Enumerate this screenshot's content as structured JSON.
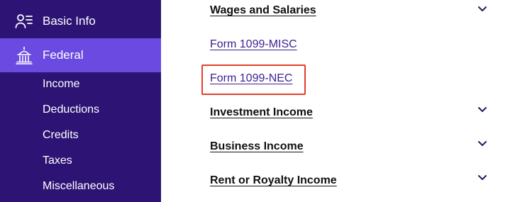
{
  "colors": {
    "sidebar_bg": "#2d1474",
    "active_bg": "#6a4ae0",
    "link": "#3b1f8f",
    "highlight": "#e2402a"
  },
  "sidebar": {
    "items": [
      {
        "label": "Basic Info",
        "icon": "person-list-icon",
        "active": false
      },
      {
        "label": "Federal",
        "icon": "capitol-building-icon",
        "active": true
      }
    ],
    "subitems": [
      "Income",
      "Deductions",
      "Credits",
      "Taxes",
      "Miscellaneous"
    ]
  },
  "main": {
    "sections": [
      {
        "title": "Wages and Salaries",
        "expanded": true,
        "icon": "chevron-down-icon"
      },
      {
        "title": "Investment Income",
        "expanded": false,
        "icon": "chevron-down-icon"
      },
      {
        "title": "Business Income",
        "expanded": false,
        "icon": "chevron-down-icon"
      },
      {
        "title": "Rent or Royalty Income",
        "expanded": false,
        "icon": "chevron-down-icon"
      }
    ],
    "forms": [
      {
        "label": "Form 1099-MISC",
        "highlighted": false
      },
      {
        "label": "Form 1099-NEC",
        "highlighted": true
      }
    ]
  }
}
